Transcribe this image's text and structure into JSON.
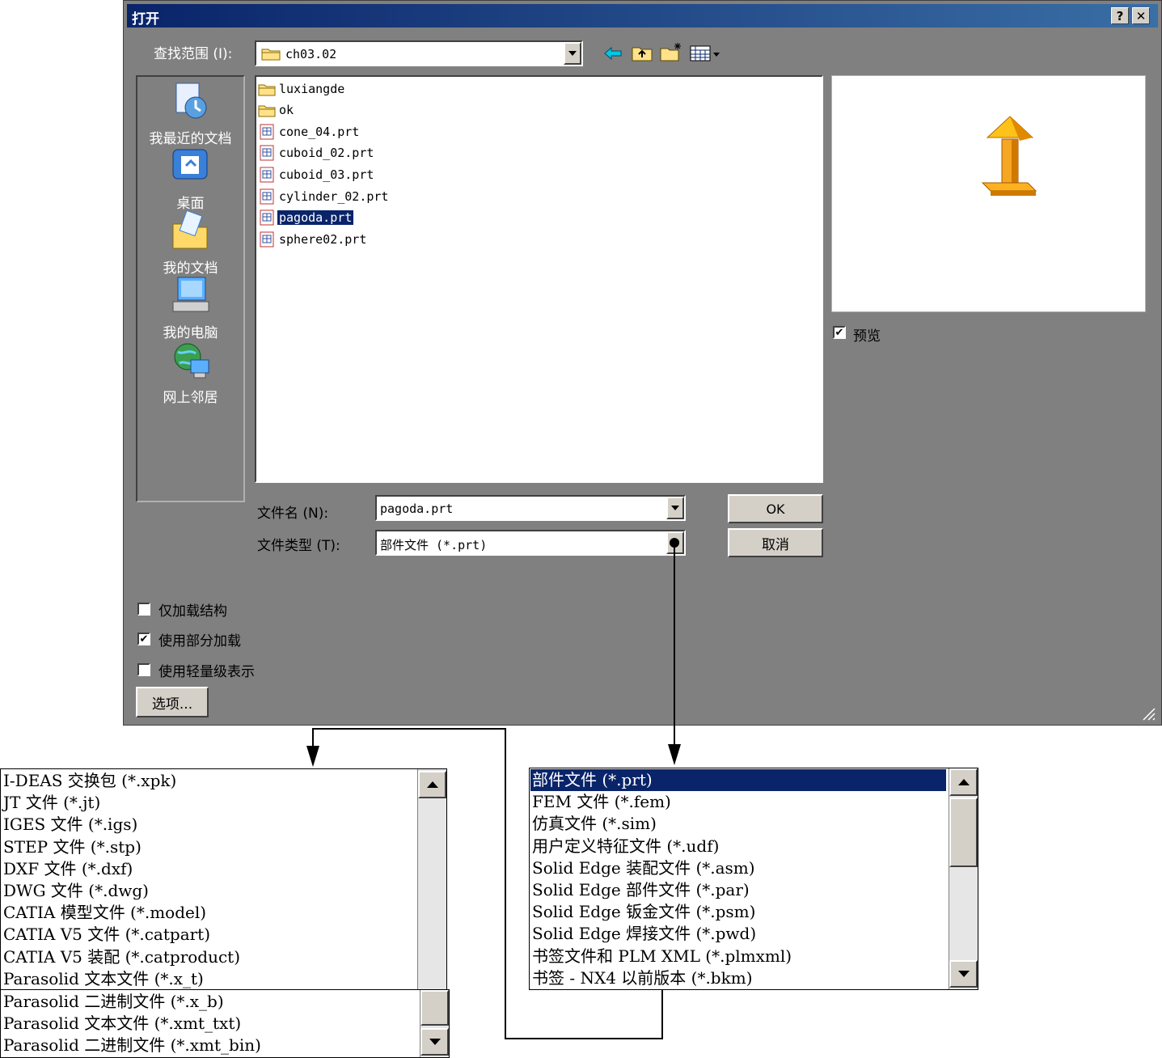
{
  "window": {
    "title": "打开",
    "help_glyph": "?",
    "close_glyph": "✕"
  },
  "look_in": {
    "label": "查找范围 (I):",
    "value": "ch03.02"
  },
  "toolbar": {
    "icons": [
      "back-arrow-icon",
      "up-folder-icon",
      "new-folder-icon",
      "view-menu-icon"
    ]
  },
  "places": [
    {
      "label": "我最近的文档",
      "icon": "recent-documents-icon"
    },
    {
      "label": "桌面",
      "icon": "desktop-icon"
    },
    {
      "label": "我的文档",
      "icon": "my-documents-icon"
    },
    {
      "label": "我的电脑",
      "icon": "my-computer-icon"
    },
    {
      "label": "网上邻居",
      "icon": "network-places-icon"
    }
  ],
  "files": [
    {
      "name": "luxiangde",
      "type": "folder"
    },
    {
      "name": "ok",
      "type": "folder"
    },
    {
      "name": "cone_04.prt",
      "type": "part"
    },
    {
      "name": "cuboid_02.prt",
      "type": "part"
    },
    {
      "name": "cuboid_03.prt",
      "type": "part"
    },
    {
      "name": "cylinder_02.prt",
      "type": "part"
    },
    {
      "name": "pagoda.prt",
      "type": "part",
      "selected": true
    },
    {
      "name": "sphere02.prt",
      "type": "part"
    }
  ],
  "preview": {
    "checkbox_label": "预览",
    "checked": true
  },
  "filename": {
    "label": "文件名 (N):",
    "value": "pagoda.prt"
  },
  "filetype": {
    "label": "文件类型 (T):",
    "value": "部件文件 (*.prt)"
  },
  "buttons": {
    "ok": "OK",
    "cancel": "取消",
    "options": "选项..."
  },
  "options": [
    {
      "label": "仅加载结构",
      "checked": false
    },
    {
      "label": "使用部分加载",
      "checked": true
    },
    {
      "label": "使用轻量级表示",
      "checked": false
    }
  ],
  "filetype_list_top": [
    "部件文件 (*.prt)",
    "FEM 文件 (*.fem)",
    "仿真文件 (*.sim)",
    "用户定义特征文件 (*.udf)",
    "Solid Edge 装配文件 (*.asm)",
    "Solid Edge 部件文件 (*.par)",
    "Solid Edge 钣金文件 (*.psm)",
    "Solid Edge 焊接文件 (*.pwd)",
    "书签文件和 PLM XML (*.plmxml)",
    "书签 - NX4 以前版本 (*.bkm)"
  ],
  "filetype_list_bottom_a": [
    "I-DEAS 交换包 (*.xpk)",
    "JT 文件 (*.jt)",
    "IGES 文件 (*.igs)",
    "STEP 文件 (*.stp)",
    "DXF 文件 (*.dxf)",
    "DWG 文件 (*.dwg)",
    "CATIA 模型文件 (*.model)",
    "CATIA V5 文件 (*.catpart)",
    "CATIA V5 装配 (*.catproduct)",
    "Parasolid 文本文件 (*.x_t)"
  ],
  "filetype_list_bottom_b": [
    "Parasolid 二进制文件 (*.x_b)",
    "Parasolid 文本文件 (*.xmt_txt)",
    "Parasolid 二进制文件 (*.xmt_bin)"
  ],
  "colors": {
    "title_start": "#0a246a",
    "title_end": "#3a6ea5",
    "selection": "#0a246a",
    "dialog_bg": "#808080",
    "preview_model": "#f5a623"
  }
}
